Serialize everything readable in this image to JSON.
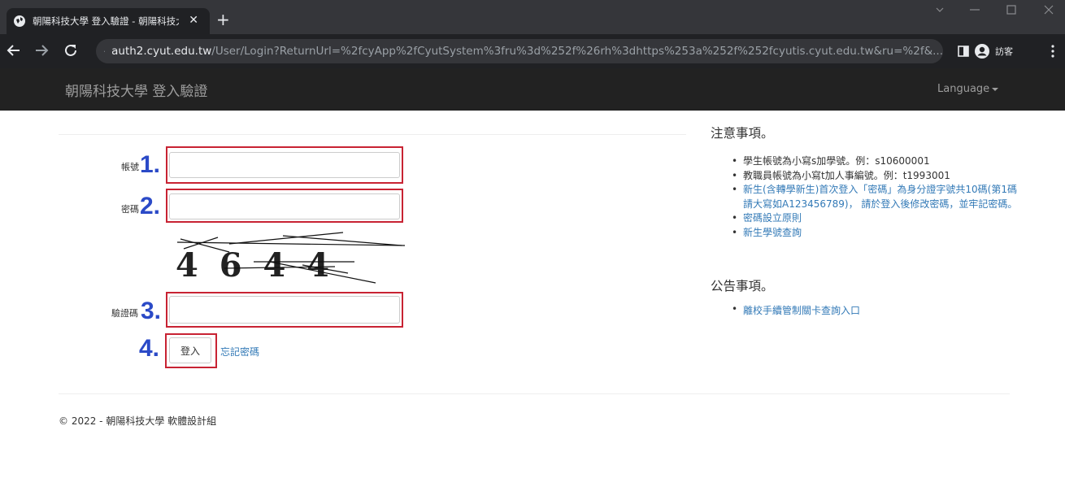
{
  "browser": {
    "tab_title": "朝陽科技大學 登入驗證 - 朝陽科技大學",
    "tab_close": "✕",
    "new_tab": "+",
    "url_host": "auth2.cyut.edu.tw",
    "url_path": "/User/Login?ReturnUrl=%2fcyApp%2fCyutSystem%3fru%3d%252f%26rh%3dhttps%253a%252f%252fcyutis.cyut.edu.tw&ru=%2f&...",
    "guest_label": "訪客",
    "icons": [
      "globe-icon",
      "back-icon",
      "forward-icon",
      "reload-icon",
      "lock-icon",
      "side-panel-icon",
      "profile-icon",
      "menu-icon",
      "minimize-icon",
      "maximize-icon",
      "close-icon"
    ]
  },
  "site": {
    "brand": "朝陽科技大學 登入驗證",
    "language": "Language"
  },
  "form": {
    "account_label": "帳號",
    "password_label": "密碼",
    "captcha_label": "驗證碼",
    "captcha_text": "4 6 4 4",
    "login_button": "登入",
    "forgot_link": "忘記密碼",
    "markers": [
      "1.",
      "2.",
      "3.",
      "4."
    ]
  },
  "notes": {
    "title": "注意事項。",
    "items": [
      "學生帳號為小寫s加學號。例：s10600001",
      "教職員帳號為小寫t加人事編號。例：t1993001",
      "新生(含轉學新生)首次登入「密碼」為身分證字號共10碼(第1碼請大寫如A123456789)， 請於登入後修改密碼，並牢記密碼。",
      "密碼設立原則",
      "新生學號查詢"
    ]
  },
  "announcements": {
    "title": "公告事項。",
    "items": [
      "離校手續管制關卡查詢入口"
    ]
  },
  "footer": "© 2022 - 朝陽科技大學 軟體設計組",
  "colors": {
    "annotation_red": "#c82333",
    "marker_blue": "#2b4ac7",
    "link_blue": "#337ab7",
    "navbar": "#222222"
  }
}
